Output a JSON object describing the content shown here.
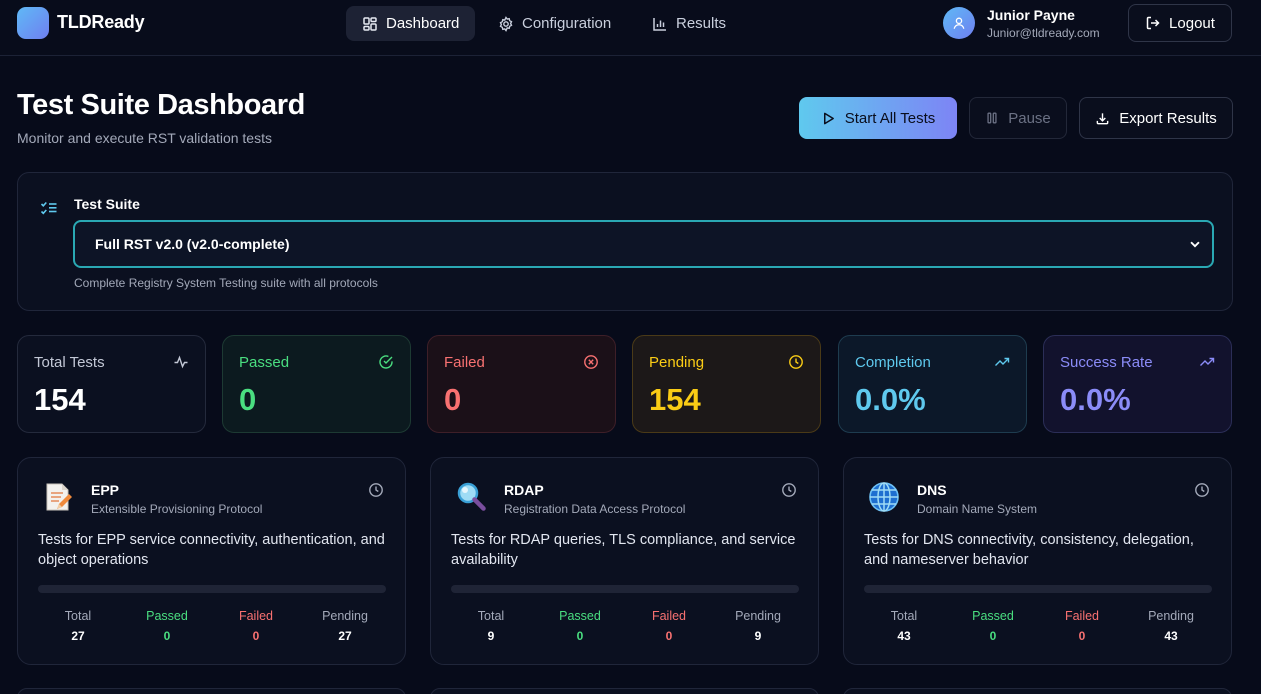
{
  "app": {
    "name": "TLDReady"
  },
  "nav": [
    {
      "label": "Dashboard",
      "icon": "grid-icon",
      "active": true
    },
    {
      "label": "Configuration",
      "icon": "gear-icon",
      "active": false
    },
    {
      "label": "Results",
      "icon": "bar-chart-icon",
      "active": false
    }
  ],
  "user": {
    "name": "Junior Payne",
    "email": "Junior@tldready.com",
    "logout_label": "Logout"
  },
  "header": {
    "title": "Test Suite Dashboard",
    "subtitle": "Monitor and execute RST validation tests",
    "start_label": "Start All Tests",
    "pause_label": "Pause",
    "export_label": "Export Results"
  },
  "suite": {
    "label": "Test Suite",
    "selected": "Full RST v2.0 (v2.0-complete)",
    "description": "Complete Registry System Testing suite with all protocols"
  },
  "stats": {
    "total": {
      "label": "Total Tests",
      "value": "154"
    },
    "passed": {
      "label": "Passed",
      "value": "0"
    },
    "failed": {
      "label": "Failed",
      "value": "0"
    },
    "pending": {
      "label": "Pending",
      "value": "154"
    },
    "completion": {
      "label": "Completion",
      "value": "0.0%"
    },
    "success": {
      "label": "Success Rate",
      "value": "0.0%"
    }
  },
  "colors": {
    "passed": "#4ade80",
    "failed": "#f87171",
    "pending": "#facc15",
    "completion": "#5fc9ee",
    "success": "#8b8cf8"
  },
  "protocols": [
    {
      "name": "EPP",
      "full": "Extensible Provisioning Protocol",
      "icon": "document-pencil-icon",
      "description": "Tests for EPP service connectivity, authentication, and object operations",
      "progress": 0,
      "total_label": "Total",
      "total": "27",
      "passed_label": "Passed",
      "passed": "0",
      "failed_label": "Failed",
      "failed": "0",
      "pending_label": "Pending",
      "pending": "27"
    },
    {
      "name": "RDAP",
      "full": "Registration Data Access Protocol",
      "icon": "magnifier-icon",
      "description": "Tests for RDAP queries, TLS compliance, and service availability",
      "progress": 0,
      "total_label": "Total",
      "total": "9",
      "passed_label": "Passed",
      "passed": "0",
      "failed_label": "Failed",
      "failed": "0",
      "pending_label": "Pending",
      "pending": "9"
    },
    {
      "name": "DNS",
      "full": "Domain Name System",
      "icon": "globe-icon",
      "description": "Tests for DNS connectivity, consistency, delegation, and nameserver behavior",
      "progress": 0,
      "total_label": "Total",
      "total": "43",
      "passed_label": "Passed",
      "passed": "0",
      "failed_label": "Failed",
      "failed": "0",
      "pending_label": "Pending",
      "pending": "43"
    }
  ]
}
